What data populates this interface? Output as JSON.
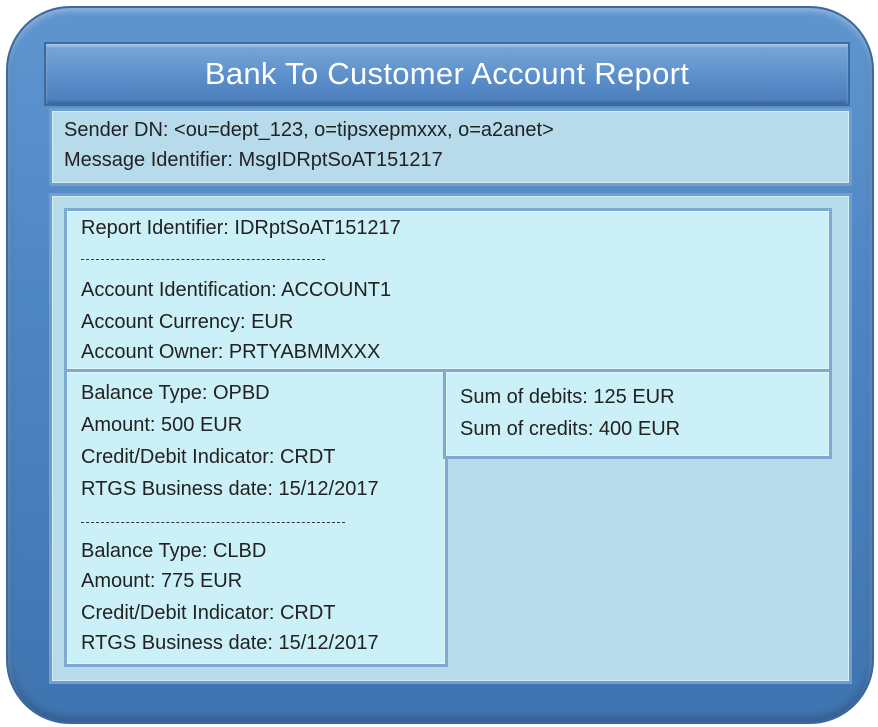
{
  "title": "Bank To Customer Account Report",
  "header": {
    "sender_dn": "Sender DN: <ou=dept_123, o=tipsxepmxxx, o=a2anet>",
    "message_identifier": "Message Identifier: MsgIDRptSoAT151217"
  },
  "account": {
    "report_identifier": "Report Identifier: IDRptSoAT151217",
    "separator": "--------------------------------",
    "account_identification": "Account Identification: ACCOUNT1",
    "account_currency": "Account Currency: EUR",
    "account_owner": "Account Owner: PRTYABMMXXX"
  },
  "balances": {
    "opening": {
      "balance_type": "Balance Type: OPBD",
      "amount": "Amount:  500 EUR",
      "indicator": "Credit/Debit Indicator: CRDT",
      "business_date": "RTGS Business date: 15/12/2017"
    },
    "separator": "---------------------------------",
    "closing": {
      "balance_type": "Balance Type: CLBD",
      "amount": "Amount:  775 EUR",
      "indicator": "Credit/Debit Indicator: CRDT",
      "business_date": "RTGS Business date: 15/12/2017"
    }
  },
  "sums": {
    "debits": "Sum of debits: 125 EUR",
    "credits": "Sum of credits: 400 EUR"
  }
}
